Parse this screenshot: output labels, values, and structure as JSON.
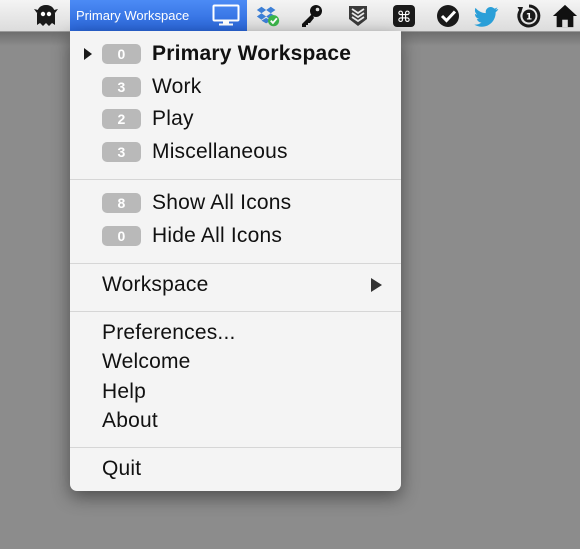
{
  "menubar": {
    "active_label": "Primary Workspace",
    "icons": [
      "ghost-app-icon",
      "dropbox-sync-icon",
      "key-icon",
      "layers-shield-icon",
      "command-key-icon",
      "checkmark-circle-icon",
      "twitter-bird-icon",
      "timer-icon",
      "home-icon"
    ]
  },
  "menu": {
    "workspaces": [
      {
        "count": "0",
        "label": "Primary Workspace",
        "current": true
      },
      {
        "count": "3",
        "label": "Work"
      },
      {
        "count": "2",
        "label": "Play"
      },
      {
        "count": "3",
        "label": "Miscellaneous"
      }
    ],
    "icon_actions": [
      {
        "count": "8",
        "label": "Show All Icons"
      },
      {
        "count": "0",
        "label": "Hide All Icons"
      }
    ],
    "workspace_submenu": "Workspace",
    "general": [
      "Preferences...",
      "Welcome",
      "Help",
      "About"
    ],
    "quit": "Quit"
  },
  "colors": {
    "highlight": "#2f6fe0",
    "badge": "#b9b9b9",
    "menu_bg": "#f4f4f4",
    "desktop": "#8c8c8c"
  }
}
